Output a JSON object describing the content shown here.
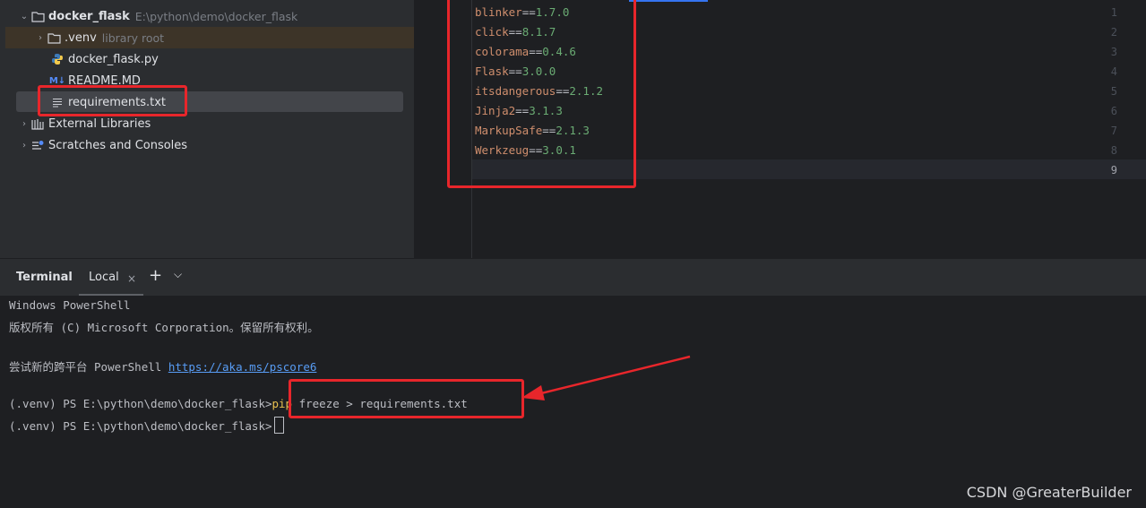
{
  "project_tree": {
    "root": {
      "name": "docker_flask",
      "path": "E:\\python\\demo\\docker_flask"
    },
    "items": [
      {
        "name": ".venv",
        "hint": "library root"
      },
      {
        "name": "docker_flask.py"
      },
      {
        "name": "README.MD",
        "icon_text": "M↓"
      },
      {
        "name": "requirements.txt"
      }
    ],
    "external_libraries": "External Libraries",
    "scratches": "Scratches and Consoles"
  },
  "editor": {
    "lines": [
      {
        "num": "1",
        "pkg": "blinker",
        "op": "==",
        "ver": "1.7.0"
      },
      {
        "num": "2",
        "pkg": "click",
        "op": "==",
        "ver": "8.1.7"
      },
      {
        "num": "3",
        "pkg": "colorama",
        "op": "==",
        "ver": "0.4.6"
      },
      {
        "num": "4",
        "pkg": "Flask",
        "op": "==",
        "ver": "3.0.0"
      },
      {
        "num": "5",
        "pkg": "itsdangerous",
        "op": "==",
        "ver": "2.1.2"
      },
      {
        "num": "6",
        "pkg": "Jinja2",
        "op": "==",
        "ver": "3.1.3"
      },
      {
        "num": "7",
        "pkg": "MarkupSafe",
        "op": "==",
        "ver": "2.1.3"
      },
      {
        "num": "8",
        "pkg": "Werkzeug",
        "op": "==",
        "ver": "3.0.1"
      },
      {
        "num": "9",
        "pkg": "",
        "op": "",
        "ver": ""
      }
    ]
  },
  "terminal": {
    "title": "Terminal",
    "tab": "Local",
    "close_glyph": "×",
    "add_glyph": "+",
    "menu_glyph": "⌵",
    "lines": {
      "l1": "Windows PowerShell",
      "l2": "版权所有 (C) Microsoft Corporation。保留所有权利。",
      "l3_prefix": "尝试新的跨平台 PowerShell ",
      "l3_link": "https://aka.ms/pscore6",
      "prompt": "(.venv) PS E:\\python\\demo\\docker_flask>",
      "cmd_pip": "pip",
      "cmd_rest": " freeze > requirements.txt"
    }
  },
  "watermark": "CSDN @GreaterBuilder",
  "colors": {
    "annotation": "#e8262b",
    "keyword": "#cf8e6d",
    "version": "#6aab73",
    "link": "#589df6"
  }
}
